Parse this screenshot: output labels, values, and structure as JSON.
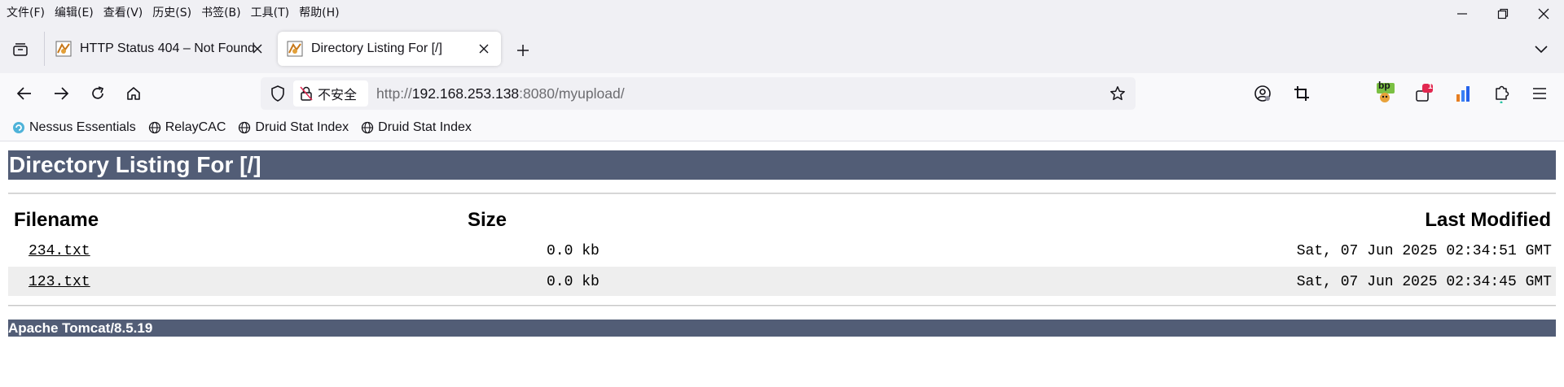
{
  "menubar": {
    "items": [
      "文件(F)",
      "编辑(E)",
      "查看(V)",
      "历史(S)",
      "书签(B)",
      "工具(T)",
      "帮助(H)"
    ]
  },
  "window_controls": {
    "icons": [
      "minimize-icon",
      "restore-icon",
      "close-icon"
    ]
  },
  "tabs": [
    {
      "title": "HTTP Status 404 – Not Found",
      "active": false,
      "icon": "tomcat-favicon"
    },
    {
      "title": "Directory Listing For [/]",
      "active": true,
      "icon": "tomcat-favicon"
    }
  ],
  "navbar": {
    "security_label": "不安全",
    "url_scheme": "http://",
    "url_host": "192.168.253.138",
    "url_rest": ":8080/myupload/"
  },
  "toolbar_icons": [
    "account-icon",
    "screenshot-crop-icon",
    "burp-extension-icon",
    "notification-extension-icon",
    "chart-extension-icon",
    "extensions-icon",
    "menu-icon"
  ],
  "extension_badge": "1",
  "burp_label": "bp",
  "bookmarks": [
    {
      "label": "Nessus Essentials",
      "icon": "nessus-icon"
    },
    {
      "label": "RelayCAC",
      "icon": "globe-icon"
    },
    {
      "label": "Druid Stat Index",
      "icon": "globe-icon"
    },
    {
      "label": "Druid Stat Index",
      "icon": "globe-icon"
    }
  ],
  "page": {
    "title": "Directory Listing For [/]",
    "columns": {
      "filename": "Filename",
      "size": "Size",
      "modified": "Last Modified"
    },
    "files": [
      {
        "name": "234.txt",
        "size": "0.0 kb",
        "modified": "Sat, 07 Jun 2025 02:34:51 GMT"
      },
      {
        "name": "123.txt",
        "size": "0.0 kb",
        "modified": "Sat, 07 Jun 2025 02:34:45 GMT"
      }
    ],
    "footer": "Apache Tomcat/8.5.19"
  },
  "colors": {
    "tomcat_header": "#525d76",
    "row_alt": "#eeeeee",
    "chrome": "#f0f0f4"
  }
}
